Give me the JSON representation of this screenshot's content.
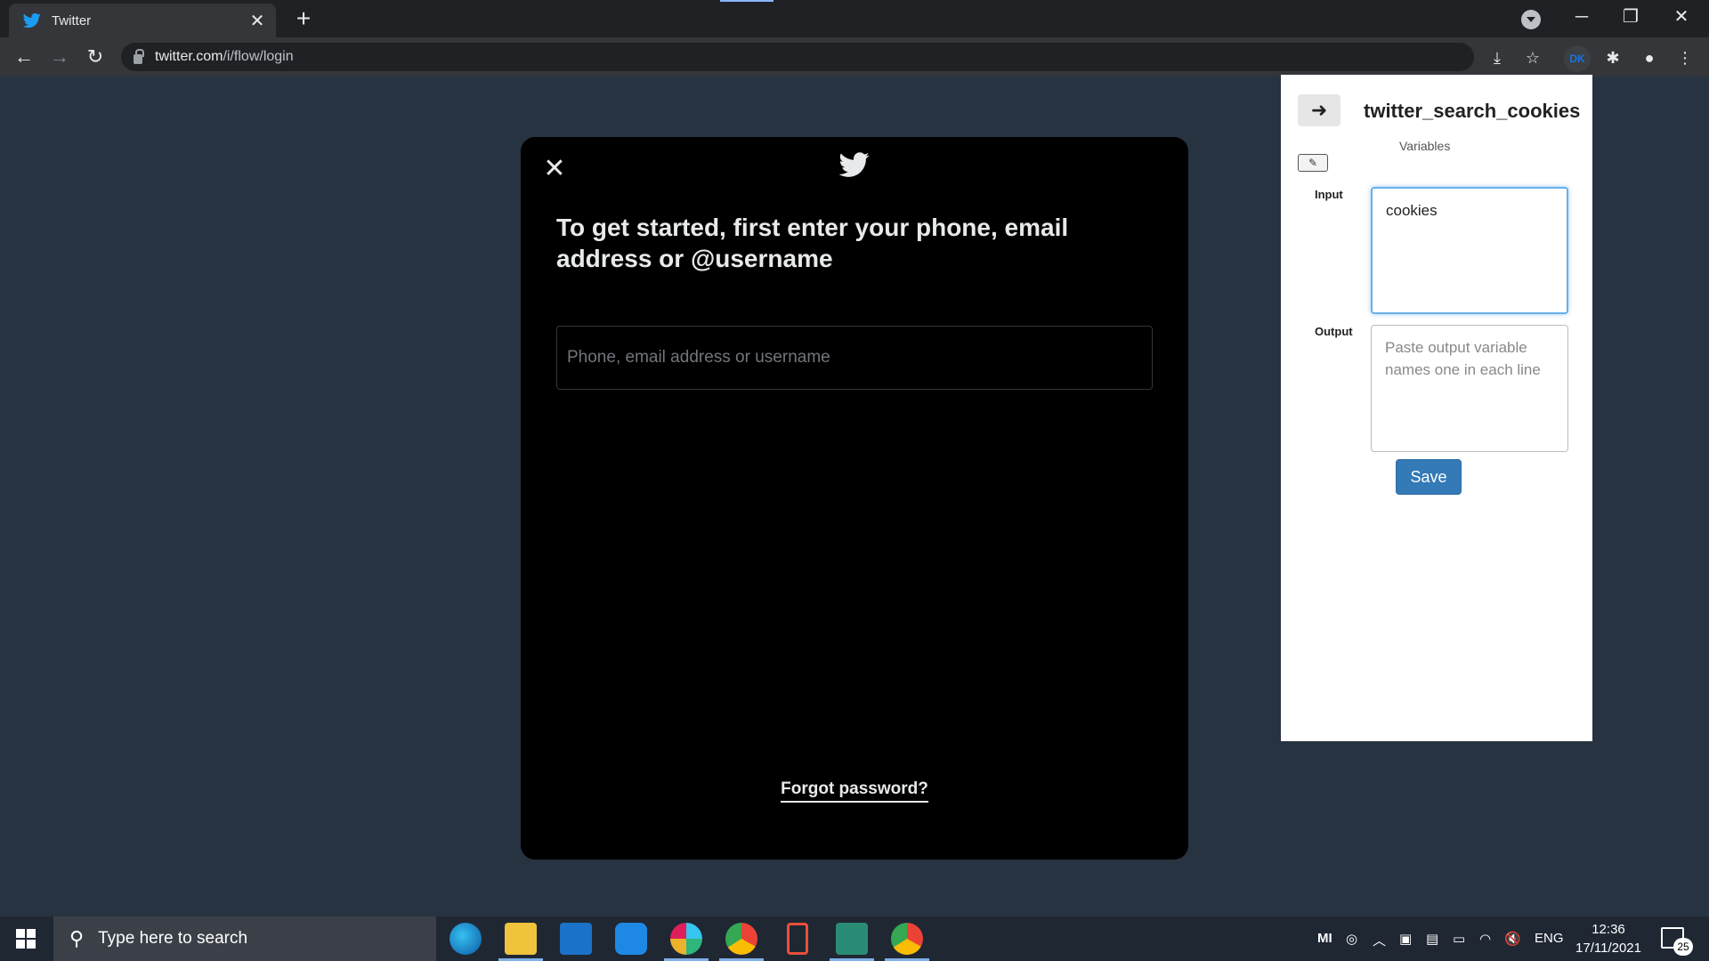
{
  "browser": {
    "tab_title": "Twitter",
    "url_host": "twitter.com",
    "url_path": "/i/flow/login",
    "profile_initials": "DK",
    "accent": "#8ab4f8"
  },
  "login_modal": {
    "heading": "To get started, first enter your phone, email address or @username",
    "input_placeholder": "Phone, email address or username",
    "input_value": "",
    "forgot_link": "Forgot password?",
    "brand_color": "#1d9bf0"
  },
  "extension": {
    "title": "twitter_search_cookies",
    "subtitle": "Variables",
    "input_label": "Input",
    "input_value": "cookies",
    "output_label": "Output",
    "output_placeholder": "Paste output variable names one in each line",
    "output_value": "",
    "save_label": "Save",
    "button_color": "#337ab7"
  },
  "taskbar": {
    "search_placeholder": "Type here to search",
    "tray_brand": "MI",
    "language": "ENG",
    "time": "12:36",
    "date": "17/11/2021",
    "notification_count": "25",
    "apps": [
      "edge-icon",
      "file-explorer-icon",
      "mail-icon",
      "store-icon",
      "slack-icon",
      "chrome-icon",
      "phone-link-icon",
      "app-window-icon",
      "chrome-active-icon"
    ]
  }
}
